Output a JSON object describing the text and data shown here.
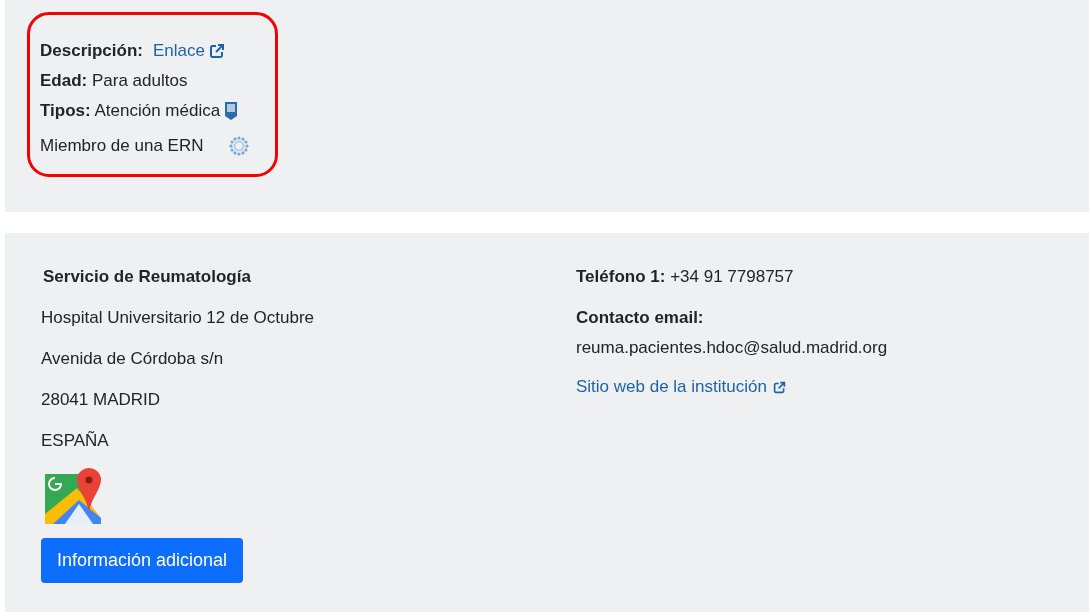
{
  "summary": {
    "highlighted": true,
    "description": {
      "label": "Descripción:",
      "link": "Enlace"
    },
    "fields": [
      {
        "text": "**Edad:** Para adultos"
      },
      {
        "text": "**Tipos:** Atención médica"
      }
    ],
    "ern_member": "Miembro de una ERN"
  },
  "contact": {
    "unit": "Servicio de Reumatología",
    "address_lines": [
      "Hospital Universitario 12 de Octubre",
      "Avenida de Córdoba s/n",
      "28041 MADRID",
      "ESPAÑA"
    ],
    "button": "Información adicional",
    "phone": "**Teléfono 1:** +34 91 7798757",
    "email_label": "Contacto email:",
    "email": "reuma.pacientes.hdoc@salud.madrid.org",
    "website_link": "Sitio web de la institución"
  }
}
